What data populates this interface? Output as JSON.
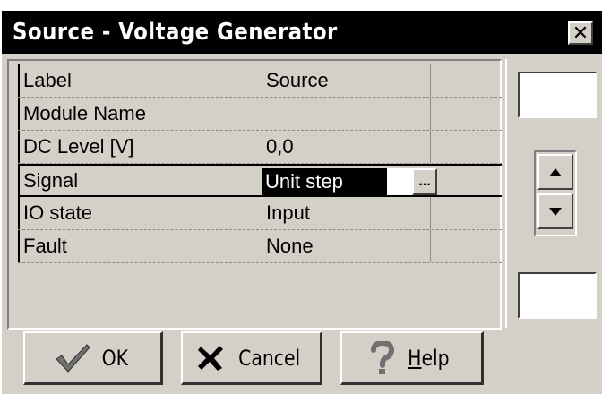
{
  "window": {
    "title": "Source - Voltage Generator",
    "close_glyph": "✕"
  },
  "grid": {
    "rows": [
      {
        "label": "Label",
        "value": "Source"
      },
      {
        "label": "Module Name",
        "value": ""
      },
      {
        "label": "DC Level [V]",
        "value": "0,0"
      },
      {
        "label": "Signal",
        "value": "Unit step",
        "selected": true
      },
      {
        "label": "IO state",
        "value": "Input"
      },
      {
        "label": "Fault",
        "value": "None"
      }
    ],
    "ellipsis_label": "..."
  },
  "buttons": {
    "ok": {
      "label": "OK",
      "icon": "checkmark-icon"
    },
    "cancel": {
      "label": "Cancel",
      "icon": "x-mark-icon"
    },
    "help": {
      "label": "Help",
      "underline": "H",
      "rest": "elp",
      "icon": "question-mark-icon"
    }
  },
  "side": {
    "top_value": "",
    "bottom_value": ""
  }
}
